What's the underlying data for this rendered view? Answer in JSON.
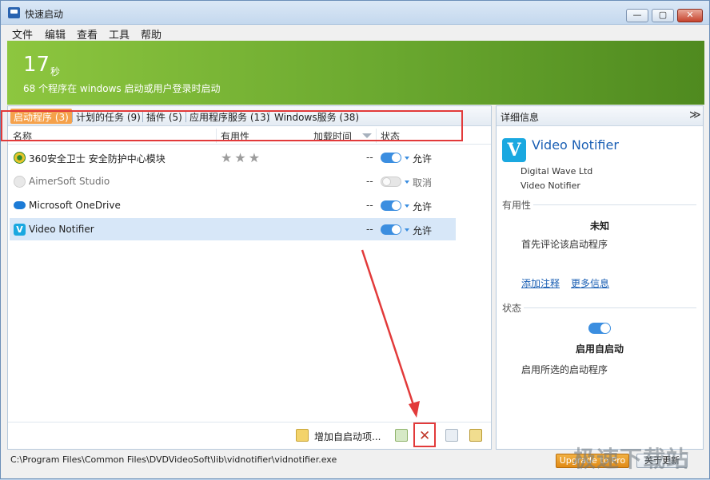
{
  "window": {
    "title": "快速启动",
    "min_glyph": "—",
    "max_glyph": "▢",
    "close_glyph": "✕"
  },
  "menu": [
    "文件",
    "编辑",
    "查看",
    "工具",
    "帮助"
  ],
  "banner": {
    "seconds": "17",
    "unit": "秒",
    "subtitle": "68 个程序在 windows 启动或用户登录时启动"
  },
  "tabs": [
    {
      "label": "启动程序 (3)",
      "active": true
    },
    {
      "label": "计划的任务 (9)"
    },
    {
      "label": "插件 (5)"
    },
    {
      "label": "应用程序服务 (13)"
    },
    {
      "label": "Windows服务 (38)"
    }
  ],
  "columns": {
    "name": "名称",
    "usefulness": "有用性",
    "load_time": "加载时间",
    "status": "状态"
  },
  "rows": [
    {
      "name": "360安全卫士 安全防护中心模块",
      "stars": "★★★",
      "load": "--",
      "status": "允许",
      "enabled": true,
      "icon": "360-shield-icon"
    },
    {
      "name": "AimerSoft Studio",
      "stars": "",
      "load": "--",
      "status": "取消",
      "enabled": false,
      "icon": "aimersoft-icon"
    },
    {
      "name": "Microsoft OneDrive",
      "stars": "",
      "load": "--",
      "status": "允许",
      "enabled": true,
      "icon": "onedrive-cloud-icon"
    },
    {
      "name": "Video Notifier",
      "stars": "",
      "load": "--",
      "status": "允许",
      "enabled": true,
      "icon": "vimeo-v-icon"
    }
  ],
  "bottom": {
    "add_label": "增加自启动项...",
    "delete_glyph": "✕"
  },
  "details": {
    "header": "详细信息",
    "collapse_glyph": "≫",
    "logo_letter": "V",
    "app_name": "Video Notifier",
    "publisher": "Digital Wave Ltd",
    "product": "Video Notifier",
    "usefulness_label": "有用性",
    "usefulness_value": "未知",
    "review_prompt": "首先评论该启动程序",
    "link_comment": "添加注释",
    "link_more": "更多信息",
    "status_label": "状态",
    "status_value": "启用自启动",
    "status_desc": "启用所选的启动程序"
  },
  "statusbar": {
    "path": "C:\\Program Files\\Common Files\\DVDVideoSoft\\lib\\vidnotifier\\vidnotifier.exe",
    "upgrade_label": "Upgrade to Pro",
    "about_label": "关于更新"
  },
  "watermark": "极速下载站",
  "colors": {
    "banner_green": "#7cbb36",
    "tab_active": "#f5a14b",
    "toggle_on": "#3b8ee0",
    "highlight_red": "#e23a3a"
  }
}
